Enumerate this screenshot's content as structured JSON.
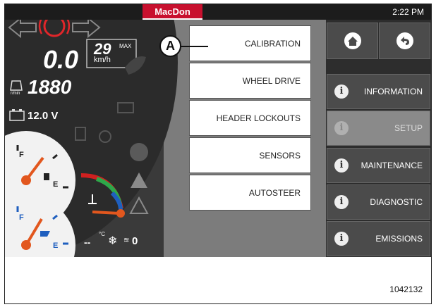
{
  "status_bar": {
    "brand": "MacDon",
    "time": "2:22 PM"
  },
  "cluster": {
    "speed_value": "0.0",
    "speed_target": "29",
    "speed_max_label": "MAX",
    "speed_unit": "km/h",
    "rpm_unit": "r/min",
    "rpm_value": "1880",
    "voltage": "12.0 V",
    "fuel_full": "F",
    "fuel_empty": "E",
    "def_full": "F",
    "def_empty": "E",
    "hvac_temp": "--",
    "hvac_temp_unit": "°C",
    "fan_level": "0",
    "colors": {
      "parking_brake": "#e0262a",
      "gauge_needle": "#e2571e"
    }
  },
  "menu": {
    "items": [
      {
        "label": "CALIBRATION"
      },
      {
        "label": "WHEEL DRIVE"
      },
      {
        "label": "HEADER LOCKOUTS"
      },
      {
        "label": "SENSORS"
      },
      {
        "label": "AUTOSTEER"
      }
    ]
  },
  "side_nav": {
    "home_icon": "home-icon",
    "back_icon": "back-icon",
    "items": [
      {
        "label": "INFORMATION",
        "icon": "info-icon",
        "active": false
      },
      {
        "label": "SETUP",
        "icon": "info-icon",
        "active": true
      },
      {
        "label": "MAINTENANCE",
        "icon": "info-icon",
        "active": false
      },
      {
        "label": "DIAGNOSTIC",
        "icon": "info-icon",
        "active": false
      },
      {
        "label": "EMISSIONS",
        "icon": "info-icon",
        "active": false
      }
    ]
  },
  "annotation": {
    "callout": "A",
    "figure_id": "1042132"
  }
}
